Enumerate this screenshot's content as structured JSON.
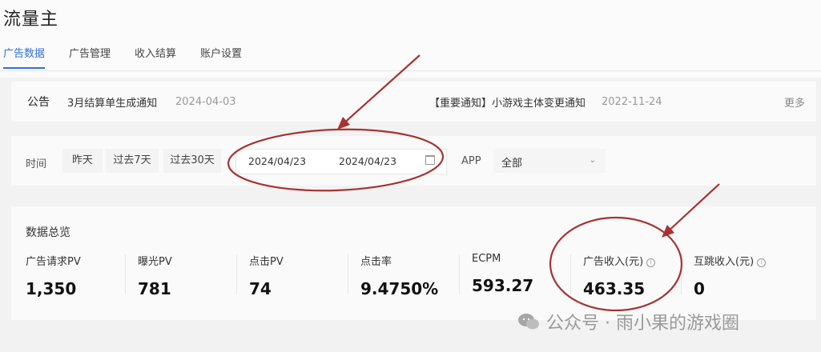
{
  "app": {
    "title": "流量主"
  },
  "tabs": [
    {
      "label": "广告数据",
      "active": true
    },
    {
      "label": "广告管理"
    },
    {
      "label": "收入结算"
    },
    {
      "label": "账户设置"
    }
  ],
  "notice": {
    "label": "公告",
    "items": [
      {
        "text": "3月结算单生成通知",
        "date": "2024-04-03"
      },
      {
        "text": "【重要通知】小游戏主体变更通知",
        "date": "2022-11-24"
      }
    ],
    "more": "更多"
  },
  "filter": {
    "time_label": "时间",
    "presets": [
      "昨天",
      "过去7天",
      "过去30天"
    ],
    "start_date": "2024/04/23",
    "end_date": "2024/04/23",
    "app_label": "APP",
    "app_value": "全部"
  },
  "overview": {
    "title": "数据总览",
    "metrics": [
      {
        "label": "广告请求PV",
        "value": "1,350"
      },
      {
        "label": "曝光PV",
        "value": "781"
      },
      {
        "label": "点击PV",
        "value": "74"
      },
      {
        "label": "点击率",
        "value": "9.4750%"
      },
      {
        "label": "ECPM",
        "value": "593.27"
      },
      {
        "label": "广告收入(元)",
        "value": "463.35"
      },
      {
        "label": "互跳收入(元)",
        "value": "0"
      }
    ]
  },
  "watermark": {
    "text": "公众号 · 雨小果的游戏圈"
  },
  "colors": {
    "accent": "#2f6fd6",
    "annotation": "#a83232"
  }
}
